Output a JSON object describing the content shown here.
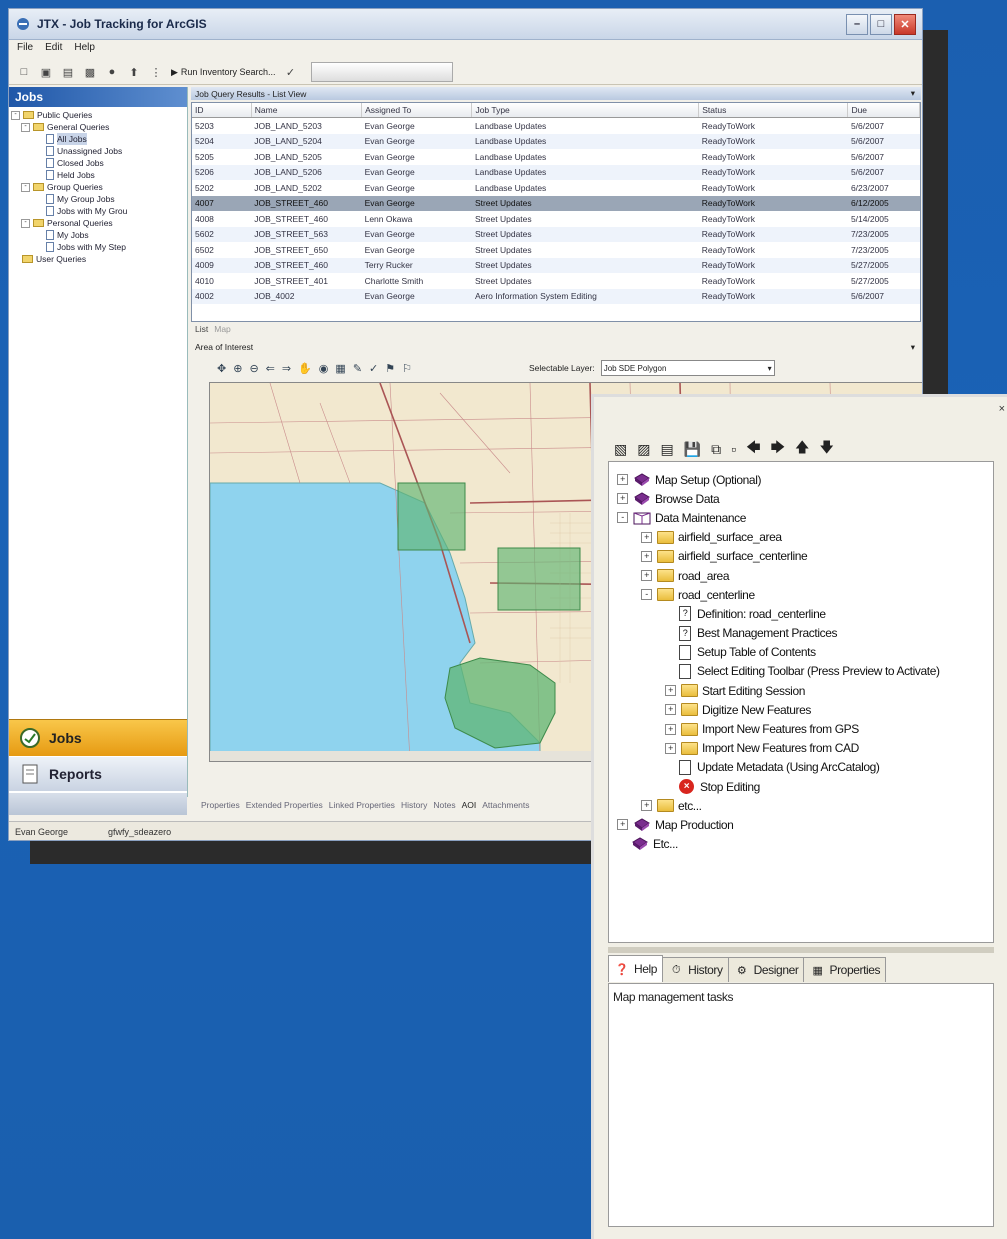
{
  "window": {
    "title": "JTX - Job Tracking for ArcGIS",
    "menu": [
      "File",
      "Edit",
      "Help"
    ],
    "toolbar_run_label": "Run Inventory Search..."
  },
  "left_pane": {
    "header": "Jobs",
    "tree": [
      {
        "label": "Public Queries",
        "level": 0,
        "type": "folder"
      },
      {
        "label": "General Queries",
        "level": 1,
        "type": "folder"
      },
      {
        "label": "All Jobs",
        "level": 2,
        "type": "doc",
        "selected": true
      },
      {
        "label": "Unassigned Jobs",
        "level": 2,
        "type": "doc"
      },
      {
        "label": "Closed Jobs",
        "level": 2,
        "type": "doc"
      },
      {
        "label": "Held Jobs",
        "level": 2,
        "type": "doc"
      },
      {
        "label": "Group Queries",
        "level": 1,
        "type": "folder"
      },
      {
        "label": "My Group Jobs",
        "level": 2,
        "type": "doc"
      },
      {
        "label": "Jobs with My Grou",
        "level": 2,
        "type": "doc"
      },
      {
        "label": "Personal Queries",
        "level": 1,
        "type": "folder"
      },
      {
        "label": "My Jobs",
        "level": 2,
        "type": "doc"
      },
      {
        "label": "Jobs with My Step",
        "level": 2,
        "type": "doc"
      },
      {
        "label": "User Queries",
        "level": 0,
        "type": "folder"
      }
    ],
    "nav_jobs": "Jobs",
    "nav_reports": "Reports"
  },
  "grid": {
    "title": "Job Query Results - List View",
    "columns": [
      "ID",
      "Name",
      "Assigned To",
      "Job Type",
      "Status",
      "Due"
    ],
    "rows": [
      [
        "5203",
        "JOB_LAND_5203",
        "Evan George",
        "Landbase Updates",
        "ReadyToWork",
        "5/6/2007"
      ],
      [
        "5204",
        "JOB_LAND_5204",
        "Evan George",
        "Landbase Updates",
        "ReadyToWork",
        "5/6/2007"
      ],
      [
        "5205",
        "JOB_LAND_5205",
        "Evan George",
        "Landbase Updates",
        "ReadyToWork",
        "5/6/2007"
      ],
      [
        "5206",
        "JOB_LAND_5206",
        "Evan George",
        "Landbase Updates",
        "ReadyToWork",
        "5/6/2007"
      ],
      [
        "5202",
        "JOB_LAND_5202",
        "Evan George",
        "Landbase Updates",
        "ReadyToWork",
        "6/23/2007"
      ],
      [
        "4007",
        "JOB_STREET_460",
        "Evan George",
        "Street Updates",
        "ReadyToWork",
        "6/12/2005"
      ],
      [
        "4008",
        "JOB_STREET_460",
        "Lenn Okawa",
        "Street Updates",
        "ReadyToWork",
        "5/14/2005"
      ],
      [
        "5602",
        "JOB_STREET_563",
        "Evan George",
        "Street Updates",
        "ReadyToWork",
        "7/23/2005"
      ],
      [
        "6502",
        "JOB_STREET_650",
        "Evan George",
        "Street Updates",
        "ReadyToWork",
        "7/23/2005"
      ],
      [
        "4009",
        "JOB_STREET_460",
        "Terry Rucker",
        "Street Updates",
        "ReadyToWork",
        "5/27/2005"
      ],
      [
        "4010",
        "JOB_STREET_401",
        "Charlotte Smith",
        "Street Updates",
        "ReadyToWork",
        "5/27/2005"
      ],
      [
        "4002",
        "JOB_4002",
        "Evan George",
        "Aero Information System Editing",
        "ReadyToWork",
        "5/6/2007"
      ]
    ],
    "selected_index": 5,
    "view_tabs": [
      "List",
      "Map"
    ]
  },
  "map_panel": {
    "title": "Area of Interest",
    "selectable_layer_label": "Selectable Layer:",
    "selectable_layer_value": "Job SDE Polygon",
    "bottom_tabs": [
      "Properties",
      "Extended Properties",
      "Linked Properties",
      "History",
      "Notes",
      "AOI",
      "Attachments"
    ]
  },
  "status_bar": {
    "user": "Evan George",
    "db": "gfwfy_sdeazero"
  },
  "side_panel": {
    "tree": [
      {
        "label": "Map Setup (Optional)",
        "indent": 0,
        "icon": "book",
        "expander": "+"
      },
      {
        "label": "Browse Data",
        "indent": 0,
        "icon": "book",
        "expander": "+"
      },
      {
        "label": "Data Maintenance",
        "indent": 0,
        "icon": "book-open",
        "expander": "-"
      },
      {
        "label": "airfield_surface_area",
        "indent": 1,
        "icon": "folder",
        "expander": "+"
      },
      {
        "label": "airfield_surface_centerline",
        "indent": 1,
        "icon": "folder",
        "expander": "+"
      },
      {
        "label": "road_area",
        "indent": 1,
        "icon": "folder",
        "expander": "+"
      },
      {
        "label": "road_centerline",
        "indent": 1,
        "icon": "folder-open",
        "expander": "-"
      },
      {
        "label": "Definition:  road_centerline",
        "indent": 2,
        "icon": "help-doc",
        "expander": ""
      },
      {
        "label": "Best Management Practices",
        "indent": 2,
        "icon": "help-doc",
        "expander": ""
      },
      {
        "label": "Setup Table of Contents",
        "indent": 2,
        "icon": "doc",
        "expander": ""
      },
      {
        "label": "Select Editing Toolbar (Press Preview to Activate)",
        "indent": 2,
        "icon": "doc",
        "expander": ""
      },
      {
        "label": "Start Editing Session",
        "indent": 2,
        "icon": "folder",
        "expander": "+"
      },
      {
        "label": "Digitize New Features",
        "indent": 2,
        "icon": "folder",
        "expander": "+"
      },
      {
        "label": "Import New Features from GPS",
        "indent": 2,
        "icon": "folder",
        "expander": "+"
      },
      {
        "label": "Import New Features from CAD",
        "indent": 2,
        "icon": "folder",
        "expander": "+"
      },
      {
        "label": "Update Metadata (Using ArcCatalog)",
        "indent": 2,
        "icon": "doc",
        "expander": ""
      },
      {
        "label": "Stop Editing",
        "indent": 2,
        "icon": "stop",
        "expander": ""
      },
      {
        "label": "etc...",
        "indent": 1,
        "icon": "folder",
        "expander": "+"
      },
      {
        "label": "Map Production",
        "indent": 0,
        "icon": "book",
        "expander": "+"
      },
      {
        "label": "Etc...",
        "indent": 0,
        "icon": "book",
        "expander": ""
      }
    ],
    "tabs": [
      {
        "label": "Help",
        "icon": "help-icon"
      },
      {
        "label": "History",
        "icon": "history-icon"
      },
      {
        "label": "Designer",
        "icon": "designer-icon"
      },
      {
        "label": "Properties",
        "icon": "properties-icon"
      }
    ],
    "help_text": "Map management tasks"
  }
}
